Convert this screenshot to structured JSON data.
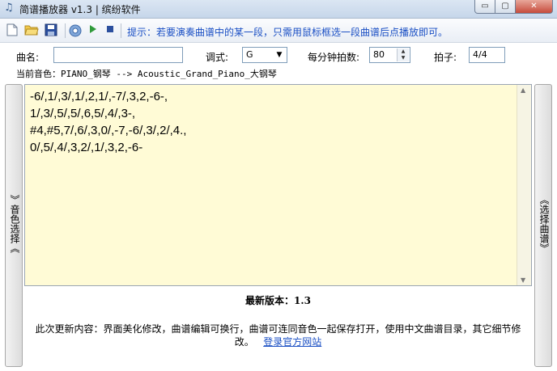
{
  "window": {
    "title": "简谱播放器 v1.3 | 缤纷软件",
    "app_icon": "music-note-icon",
    "controls": {
      "minimize": "▭",
      "maximize": "▢",
      "close": "✕"
    }
  },
  "toolbar": {
    "icons": [
      "new-file-icon",
      "open-folder-icon",
      "save-disk-icon",
      "settings-gear-icon",
      "play-icon",
      "stop-icon"
    ],
    "hint": "提示：若要演奏曲谱中的某一段，只需用鼠标框选一段曲谱后点播放即可。"
  },
  "form": {
    "song_name_label": "曲名:",
    "song_name_value": "",
    "key_label": "调式:",
    "key_value": "G",
    "bpm_label": "每分钟拍数:",
    "bpm_value": "80",
    "meter_label": "拍子:",
    "meter_value": "4/4"
  },
  "current_voice": "当前音色：PIANO_钢琴 --> Acoustic_Grand_Piano_大钢琴",
  "side_tabs": {
    "left": "》音色选择《",
    "right": "《选择曲谱》"
  },
  "score_text": "-6/,1/,3/,1/,2,1/,-7/,3,2,-6-,\n1/,3/,5/,5/,6,5/,4/,3-,\n#4,#5,7/,6/,3,0/,-7,-6/,3/,2/,4.,\n0/,5/,4/,3,2/,1/,3,2,-6-",
  "update": {
    "version_title": "最新版本：1.3",
    "notes": "此次更新内容：界面美化修改，曲谱编辑可换行，曲谱可连同音色一起保存打开，使用中文曲谱目录，其它细节修改。",
    "link": "登录官方网站"
  },
  "colors": {
    "hint": "#1a4fc4",
    "editor_bg": "#fffbd6",
    "link": "#1a4fc4"
  }
}
